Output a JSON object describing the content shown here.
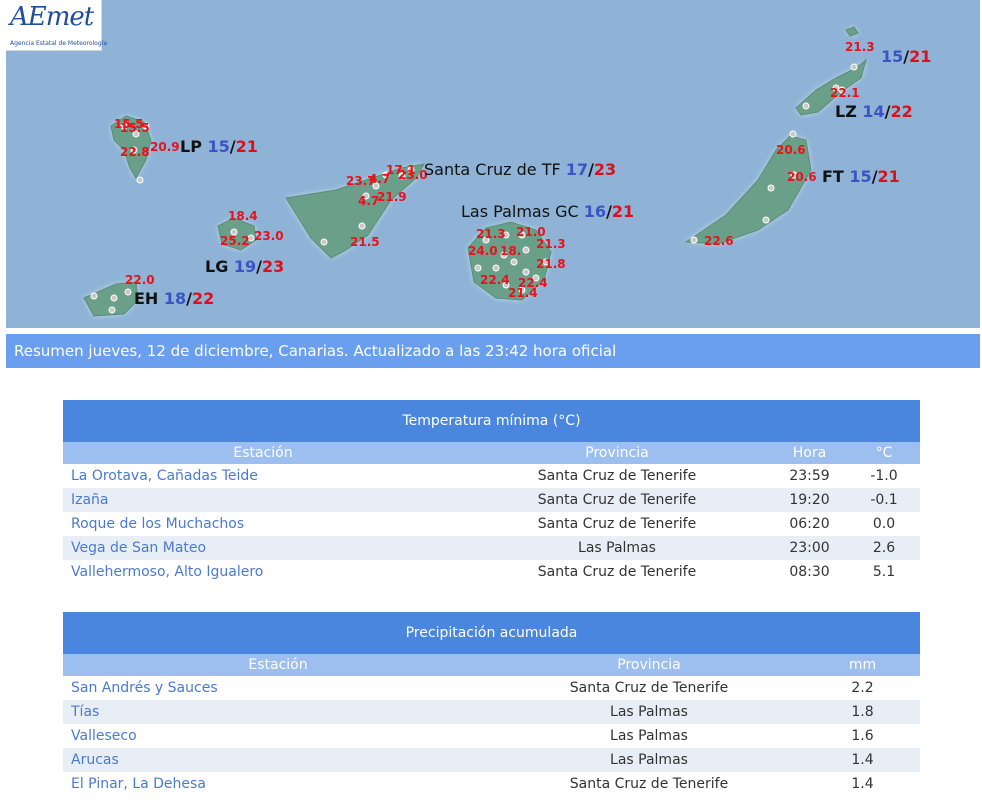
{
  "logo": {
    "brand": "AEmet",
    "agency": "Agencia Estatal de Meteorología"
  },
  "map": {
    "islands": {
      "lp": {
        "code": "LP",
        "min": "15",
        "max": "21"
      },
      "tf": {
        "name": "Santa Cruz de TF",
        "min": "17",
        "max": "23"
      },
      "gc": {
        "name": "Las Palmas GC",
        "min": "16",
        "max": "21"
      },
      "lg": {
        "code": "LG",
        "min": "19",
        "max": "23"
      },
      "eh": {
        "code": "EH",
        "min": "18",
        "max": "22"
      },
      "lz": {
        "code": "LZ",
        "min": "14",
        "max": "22"
      },
      "ft": {
        "code": "FT",
        "min": "15",
        "max": "21"
      },
      "lgr": {
        "min": "15",
        "max": "21"
      }
    },
    "station_temps": {
      "lp_a": "15.5",
      "lp_b": "15.5",
      "lp_c": "20.9",
      "lp_d": "22.8",
      "tf_a": "23.7",
      "tf_b": "4.7",
      "tf_c": "17.1",
      "tf_d": "23.0",
      "tf_e": "21.9",
      "tf_f": "4.7",
      "tf_g": "21.5",
      "lg_a": "18.4",
      "lg_b": "25.2",
      "lg_c": "23.0",
      "eh_a": "22.0",
      "gc_a": "21.3",
      "gc_b": "21.0",
      "gc_c": "24.0",
      "gc_d": "18.",
      "gc_e": "21.3",
      "gc_f": "21.8",
      "gc_g": "22.4",
      "gc_h": "22.4",
      "gc_i": "21.4",
      "lz_a": "21.3",
      "lz_b": "22.1",
      "ft_a": "20.6",
      "ft_b": "20.6",
      "ft_c": "22.6"
    }
  },
  "summary": "Resumen jueves, 12 de diciembre, Canarias. Actualizado a las 23:42 hora oficial",
  "tmin": {
    "title": "Temperatura mínima (°C)",
    "headers": {
      "station": "Estación",
      "province": "Provincia",
      "time": "Hora",
      "value": "°C"
    },
    "rows": [
      {
        "station": "La Orotava, Cañadas Teide",
        "province": "Santa Cruz de Tenerife",
        "time": "23:59",
        "value": "-1.0"
      },
      {
        "station": "Izaña",
        "province": "Santa Cruz de Tenerife",
        "time": "19:20",
        "value": "-0.1"
      },
      {
        "station": "Roque de los Muchachos",
        "province": "Santa Cruz de Tenerife",
        "time": "06:20",
        "value": "0.0"
      },
      {
        "station": "Vega de San Mateo",
        "province": "Las Palmas",
        "time": "23:00",
        "value": "2.6"
      },
      {
        "station": "Vallehermoso, Alto Igualero",
        "province": "Santa Cruz de Tenerife",
        "time": "08:30",
        "value": "5.1"
      }
    ]
  },
  "precip": {
    "title": "Precipitación acumulada",
    "headers": {
      "station": "Estación",
      "province": "Provincia",
      "value": "mm"
    },
    "rows": [
      {
        "station": "San Andrés y Sauces",
        "province": "Santa Cruz de Tenerife",
        "value": "2.2"
      },
      {
        "station": "Tías",
        "province": "Las Palmas",
        "value": "1.8"
      },
      {
        "station": "Valleseco",
        "province": "Las Palmas",
        "value": "1.6"
      },
      {
        "station": "Arucas",
        "province": "Las Palmas",
        "value": "1.4"
      },
      {
        "station": "El Pinar, La Dehesa",
        "province": "Santa Cruz de Tenerife",
        "value": "1.4"
      }
    ]
  },
  "colors": {
    "sea": "#8eb3d6",
    "island": "#6a9f8a",
    "temp": "#e8121b",
    "min": "#3a54c4",
    "max": "#d9111b",
    "summary_bg": "#6a9ff0",
    "table_header": "#4a86dd",
    "column_header": "#9dbff0",
    "row_alt": "#e8eef5",
    "station_link": "#4a7ad0"
  }
}
